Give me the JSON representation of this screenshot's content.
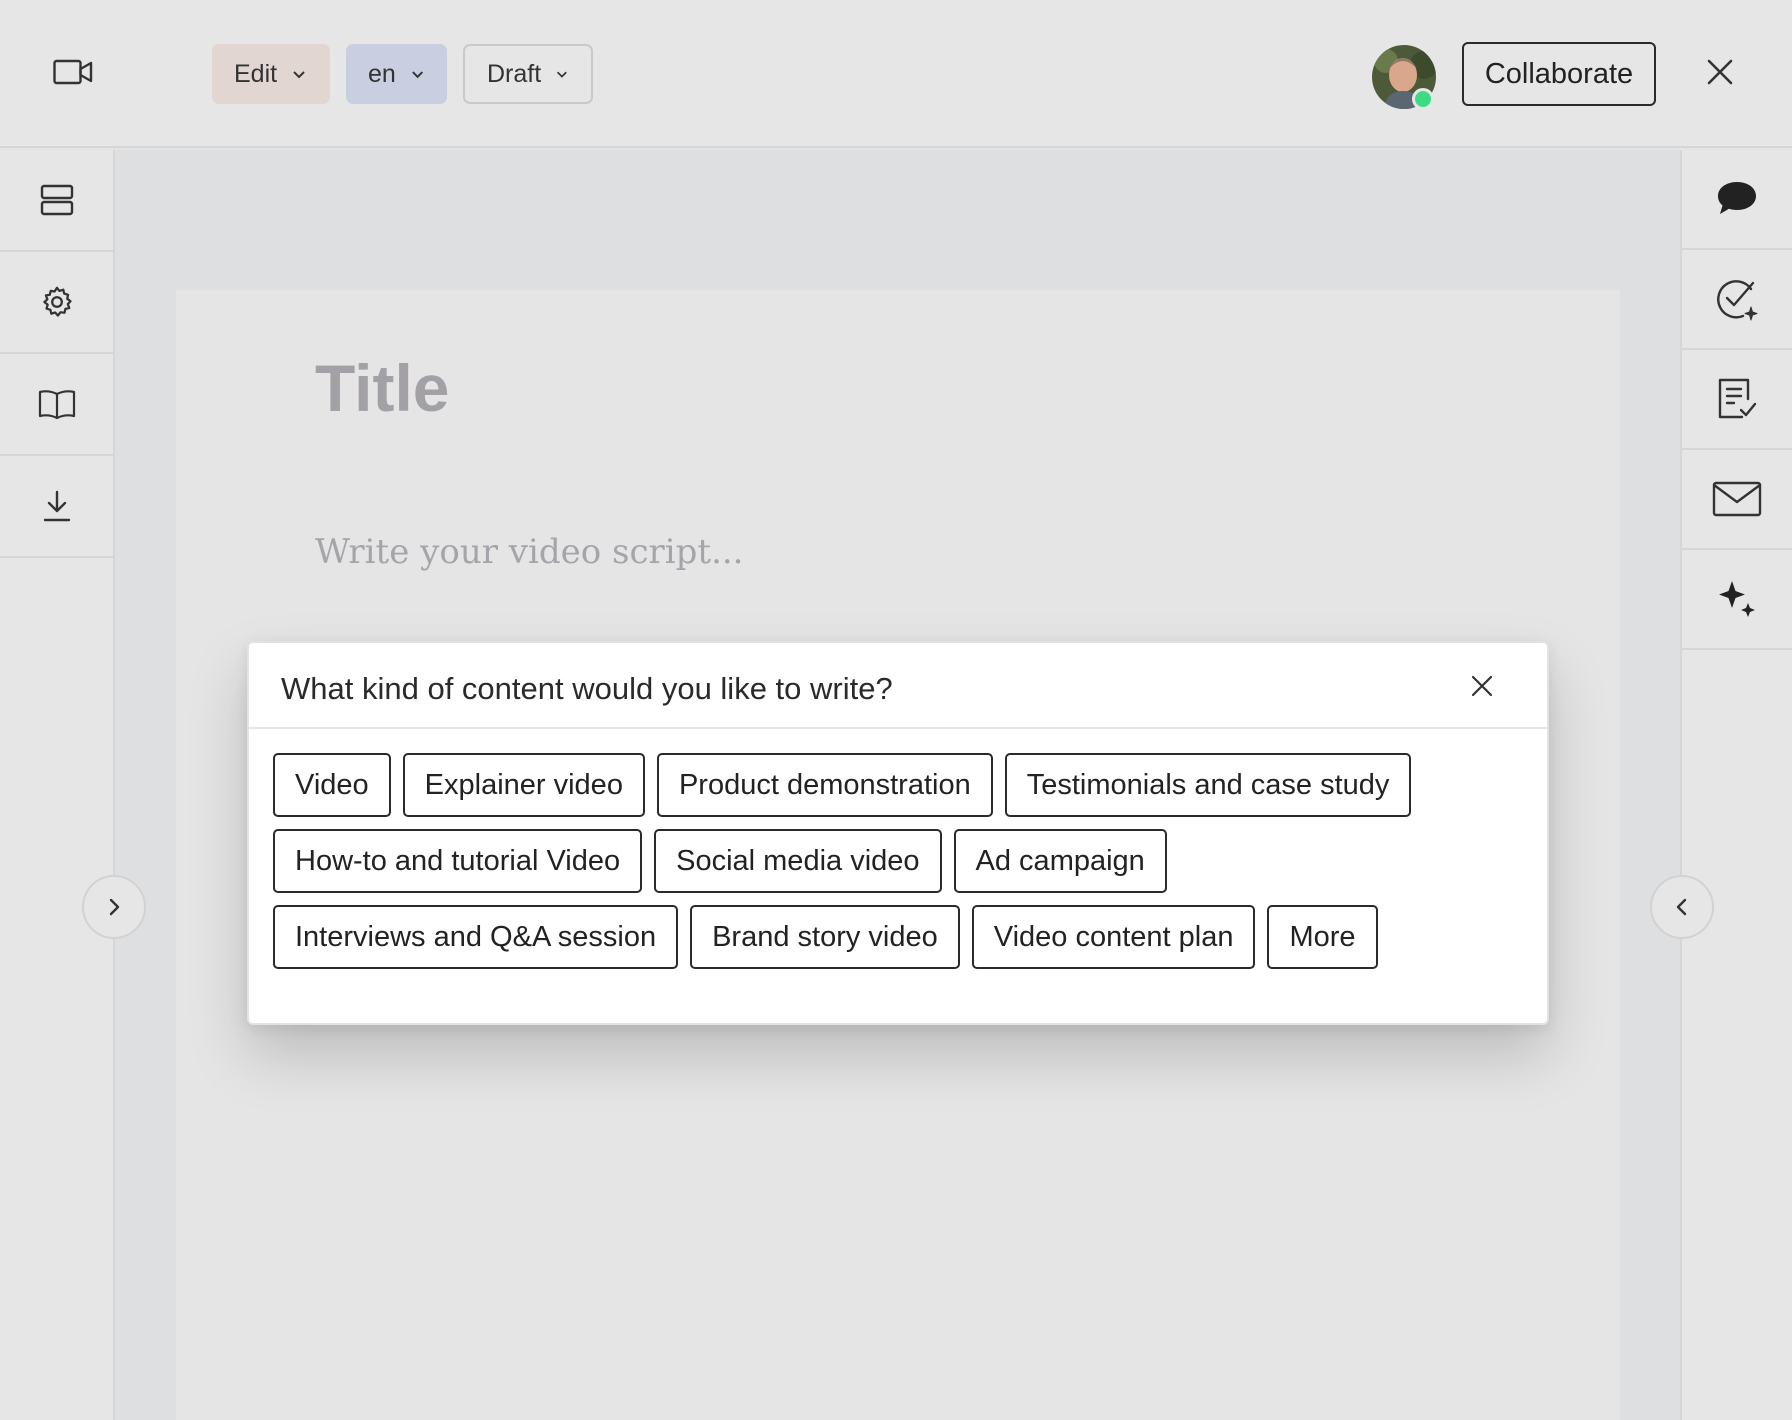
{
  "header": {
    "mode_dropdown": "Edit",
    "language_dropdown": "en",
    "status_dropdown": "Draft",
    "collaborate_label": "Collaborate",
    "presence_color": "#3ddc84"
  },
  "left_sidebar": {
    "icons": [
      "layout-icon",
      "gear-icon",
      "book-icon",
      "download-icon"
    ]
  },
  "right_sidebar": {
    "icons": [
      "chat-bubble-icon",
      "check-sparkle-icon",
      "checklist-document-icon",
      "mail-icon",
      "sparkle-icon"
    ]
  },
  "editor": {
    "title_placeholder": "Title",
    "body_placeholder": "Write your video script..."
  },
  "prompt_modal": {
    "question": "What kind of content would you like to write?",
    "rows": [
      [
        "Video",
        "Explainer video",
        "Product demonstration",
        "Testimonials and case study"
      ],
      [
        "How-to and tutorial Video",
        "Social media video",
        "Ad campaign"
      ],
      [
        "Interviews and Q&A session",
        "Brand story video",
        "Video content plan",
        "More"
      ]
    ]
  }
}
